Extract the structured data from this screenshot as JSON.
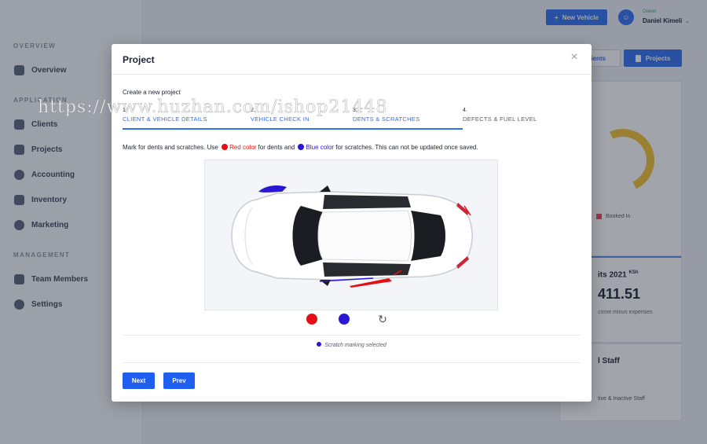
{
  "sidebar": {
    "sections": [
      {
        "title": "OVERVIEW",
        "items": [
          {
            "label": "Overview",
            "icon": "activity-icon"
          }
        ]
      },
      {
        "title": "APPLICATION",
        "items": [
          {
            "label": "Clients",
            "icon": "users-icon"
          },
          {
            "label": "Projects",
            "icon": "document-icon"
          },
          {
            "label": "Accounting",
            "icon": "currency-icon"
          },
          {
            "label": "Inventory",
            "icon": "clipboard-icon"
          },
          {
            "label": "Marketing",
            "icon": "chat-icon"
          }
        ]
      },
      {
        "title": "MANAGEMENT",
        "items": [
          {
            "label": "Team Members",
            "icon": "team-icon"
          },
          {
            "label": "Settings",
            "icon": "gear-icon"
          }
        ]
      }
    ]
  },
  "header": {
    "new_vehicle_label": "New Vehicle",
    "user_role": "Owner",
    "user_name": "Daniel Kimeli"
  },
  "background": {
    "clients_btn_label": "lients",
    "projects_btn_label": "Projects",
    "booked_in_label": "Booked In",
    "profits_title": "its 2021",
    "profits_currency": "KSh",
    "profits_value": "411.51",
    "profits_sub": "come minus expenses",
    "staff_title": "l Staff",
    "staff_sub": "tive & Inactive Staff"
  },
  "modal": {
    "title": "Project",
    "subtitle": "Create a new project",
    "steps": [
      {
        "num": "1.",
        "label": "CLIENT & VEHICLE DETAILS",
        "active": true
      },
      {
        "num": "2.",
        "label": "VEHICLE CHECK IN",
        "active": true
      },
      {
        "num": "3.",
        "label": "DENTS & SCRATCHES",
        "active": true
      },
      {
        "num": "4.",
        "label": "DEFECTS & FUEL LEVEL",
        "active": false
      }
    ],
    "instruction": {
      "prefix": "Mark for dents and scratches. Use",
      "red_label": "Red color",
      "middle": "for dents and",
      "blue_label": "Blue color",
      "suffix": "for scratches. This can not be updated once saved."
    },
    "status_text": "Scratch marking selected",
    "next_label": "Next",
    "prev_label": "Prev"
  },
  "colors": {
    "accent": "#2f6ff2",
    "dent_red": "#e30f14",
    "scratch_blue": "#2a17d4"
  },
  "watermark": "https://www.huzhan.com/ishop21448"
}
